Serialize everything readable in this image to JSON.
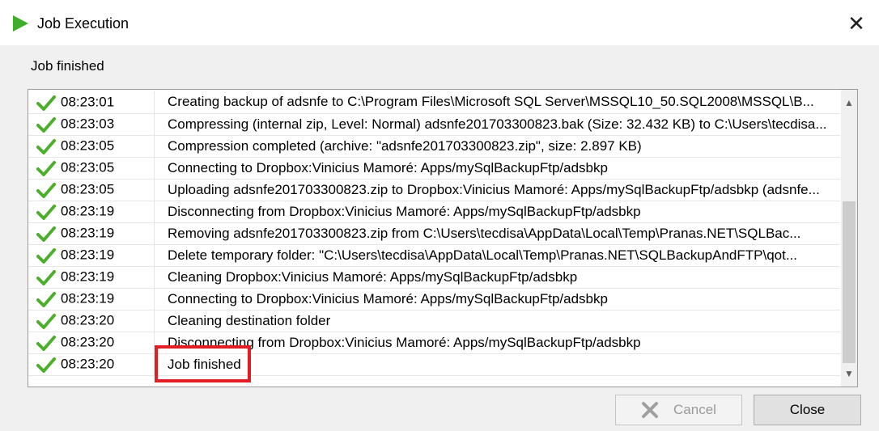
{
  "window": {
    "title": "Job Execution",
    "close_glyph": "✕"
  },
  "status": {
    "text": "Job finished"
  },
  "log": {
    "rows": [
      {
        "time": "08:23:01",
        "message": "Creating backup of adsnfe to C:\\Program Files\\Microsoft SQL Server\\MSSQL10_50.SQL2008\\MSSQL\\B..."
      },
      {
        "time": "08:23:03",
        "message": "Compressing (internal zip, Level: Normal) adsnfe201703300823.bak (Size: 32.432 KB) to C:\\Users\\tecdisa..."
      },
      {
        "time": "08:23:05",
        "message": "Compression completed (archive: \"adsnfe201703300823.zip\", size: 2.897 KB)"
      },
      {
        "time": "08:23:05",
        "message": "Connecting to Dropbox:Vinicius Mamoré: Apps/mySqlBackupFtp/adsbkp"
      },
      {
        "time": "08:23:05",
        "message": "Uploading adsnfe201703300823.zip to Dropbox:Vinicius Mamoré: Apps/mySqlBackupFtp/adsbkp (adsnfe..."
      },
      {
        "time": "08:23:19",
        "message": "Disconnecting from Dropbox:Vinicius Mamoré: Apps/mySqlBackupFtp/adsbkp"
      },
      {
        "time": "08:23:19",
        "message": "Removing adsnfe201703300823.zip from C:\\Users\\tecdisa\\AppData\\Local\\Temp\\Pranas.NET\\SQLBac..."
      },
      {
        "time": "08:23:19",
        "message": "Delete temporary folder: \"C:\\Users\\tecdisa\\AppData\\Local\\Temp\\Pranas.NET\\SQLBackupAndFTP\\qot..."
      },
      {
        "time": "08:23:19",
        "message": "Cleaning Dropbox:Vinicius Mamoré: Apps/mySqlBackupFtp/adsbkp"
      },
      {
        "time": "08:23:19",
        "message": "Connecting to Dropbox:Vinicius Mamoré: Apps/mySqlBackupFtp/adsbkp"
      },
      {
        "time": "08:23:20",
        "message": "Cleaning destination folder"
      },
      {
        "time": "08:23:20",
        "message": "Disconnecting from Dropbox:Vinicius Mamoré: Apps/mySqlBackupFtp/adsbkp"
      },
      {
        "time": "08:23:20",
        "message": "Job finished"
      }
    ]
  },
  "buttons": {
    "cancel_label": "Cancel",
    "close_label": "Close"
  },
  "icons": {
    "title": "play-triangle-icon",
    "row_status": "checkmark-icon",
    "cancel": "cancel-x-icon"
  },
  "colors": {
    "check": "#4caf2b",
    "title_icon": "#3fae2a",
    "highlight": "#e31d24"
  }
}
